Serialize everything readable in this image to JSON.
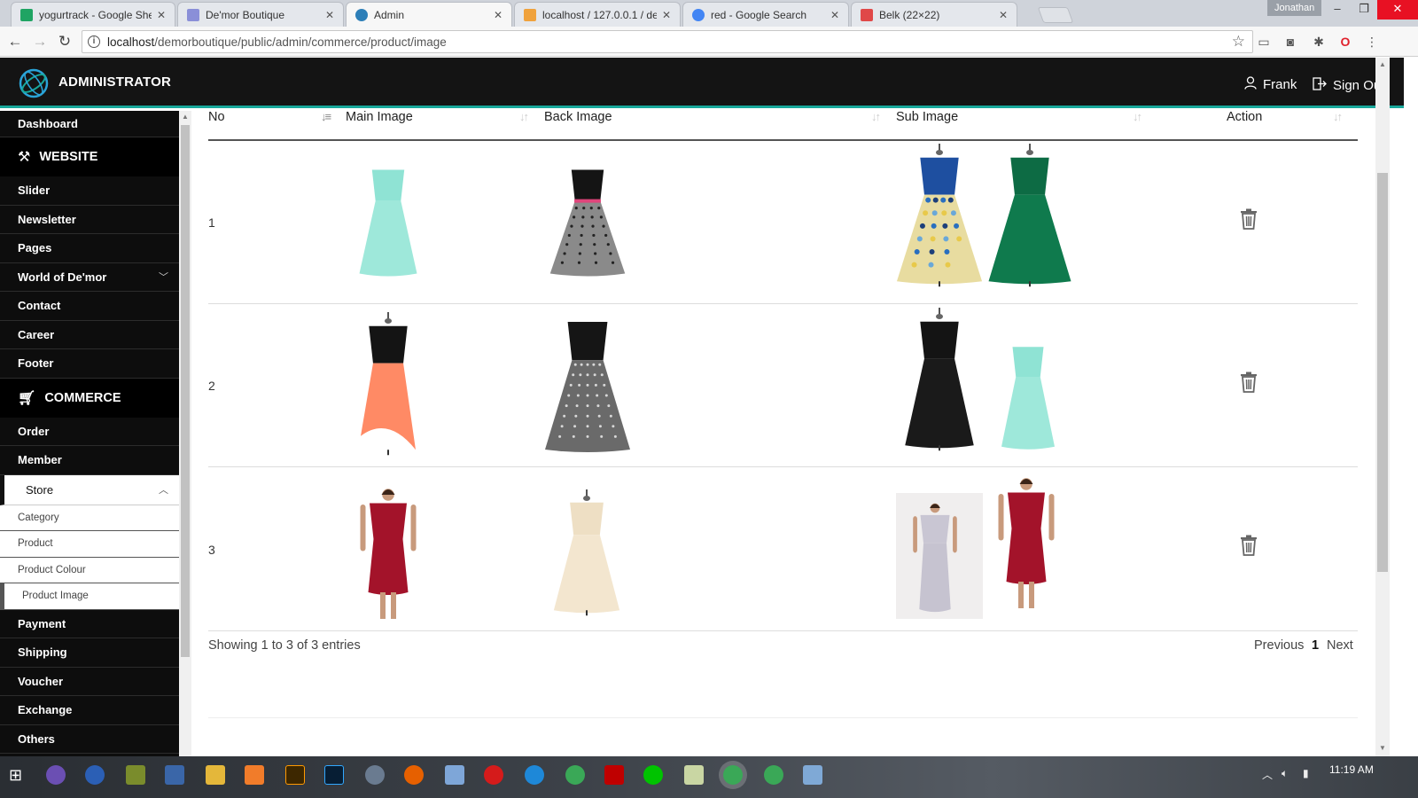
{
  "browser": {
    "tabs": [
      {
        "title": "yogurtrack - Google She",
        "fav_color": "#1fa463"
      },
      {
        "title": "De'mor Boutique",
        "fav_color": "#8a8fd8"
      },
      {
        "title": "Admin",
        "fav_color": "#2d7fb8"
      },
      {
        "title": "localhost / 127.0.0.1 / de",
        "fav_color": "#f0a23c"
      },
      {
        "title": "red - Google Search",
        "fav_color": "#4285f4"
      },
      {
        "title": "Belk (22×22)",
        "fav_color": "#e04848"
      }
    ],
    "profile_name": "Jonathan",
    "url_host": "localhost",
    "url_path": "/demorboutique/public/admin/commerce/product/image"
  },
  "header": {
    "brand": "ADMINISTRATOR",
    "user": "Frank",
    "signout": "Sign Out"
  },
  "sidebar": {
    "dashboard": "Dashboard",
    "website_section": "WEBSITE",
    "website_items": [
      "Slider",
      "Newsletter",
      "Pages",
      "World of De'mor",
      "Contact",
      "Career",
      "Footer"
    ],
    "commerce_section": "COMMERCE",
    "commerce_items": [
      "Order",
      "Member"
    ],
    "store": "Store",
    "store_items": [
      "Category",
      "Product",
      "Product Colour",
      "Product Image"
    ],
    "more_items": [
      "Payment",
      "Shipping",
      "Voucher",
      "Exchange",
      "Others"
    ]
  },
  "table": {
    "columns": [
      "No",
      "Main Image",
      "Back Image",
      "Sub Image",
      "Action"
    ],
    "rows": [
      {
        "no": "1",
        "main": "mint strapless chiffon dress",
        "back": "black lace top polka dot tulle dress",
        "subs": [
          "blue floral print sundress on mannequin",
          "green pleated dress on mannequin"
        ]
      },
      {
        "no": "2",
        "main": "coral hi-low strapless dress",
        "back": "black v-neck sequin skirt dress",
        "subs": [
          "black wrap dress on mannequin",
          "mint strapless chiffon dress"
        ]
      },
      {
        "no": "3",
        "main": "model in red fitted dress",
        "back": "cream lace dress on mannequin",
        "subs": [
          "model in grey off-shoulder gown",
          "model in red fitted dress"
        ]
      }
    ]
  },
  "footer": {
    "info": "Showing 1 to 3 of 3 entries",
    "prev": "Previous",
    "page": "1",
    "next": "Next"
  },
  "taskbar": {
    "time": "11:19 AM"
  },
  "colors": {
    "header_bg": "#141414",
    "accent": "#18a89b",
    "sidebar_bg": "#0d0d0d",
    "mint": "#8fe3d4",
    "coral": "#ff8a65",
    "red_dress": "#a3132a",
    "green_dress": "#0d6b44"
  }
}
